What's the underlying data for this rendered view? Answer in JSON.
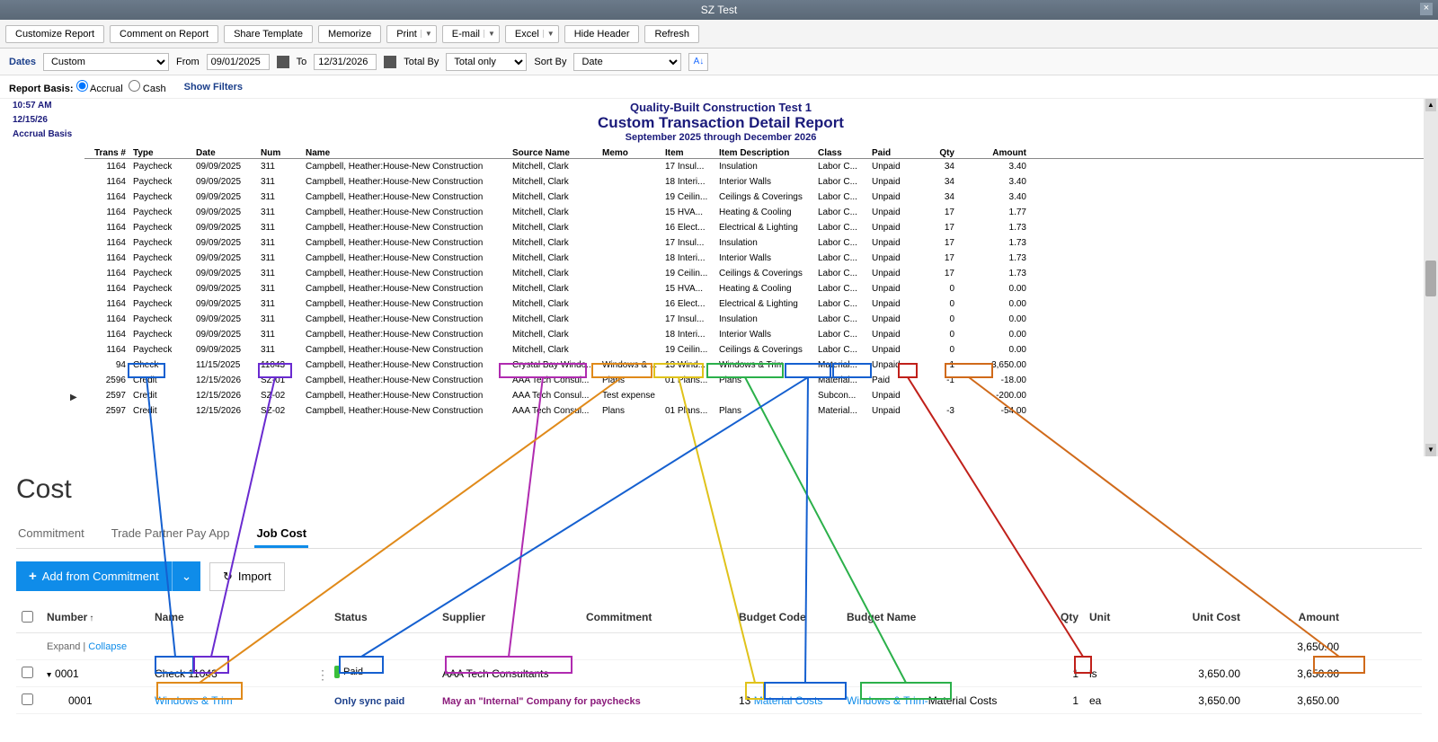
{
  "qb": {
    "window_title": "SZ Test",
    "toolbar": {
      "customize": "Customize Report",
      "comment": "Comment on Report",
      "share": "Share Template",
      "memorize": "Memorize",
      "print": "Print",
      "email": "E-mail",
      "excel": "Excel",
      "hide_header": "Hide Header",
      "refresh": "Refresh"
    },
    "filters": {
      "dates_label": "Dates",
      "dates_value": "Custom",
      "from_label": "From",
      "from_value": "09/01/2025",
      "to_label": "To",
      "to_value": "12/31/2026",
      "totalby_label": "Total By",
      "totalby_value": "Total only",
      "sortby_label": "Sort By",
      "sortby_value": "Date"
    },
    "basis": {
      "label": "Report Basis:",
      "accrual": "Accrual",
      "cash": "Cash",
      "show_filters": "Show Filters"
    },
    "meta": {
      "time": "10:57 AM",
      "date": "12/15/26",
      "basis": "Accrual Basis"
    },
    "header": {
      "company": "Quality-Built Construction Test 1",
      "title": "Custom Transaction Detail Report",
      "range": "September 2025 through December 2026"
    },
    "cols": [
      "Trans #",
      "Type",
      "Date",
      "Num",
      "Name",
      "Source Name",
      "Memo",
      "Item",
      "Item Description",
      "Class",
      "Paid",
      "Qty",
      "Amount"
    ],
    "rows": [
      {
        "trans": "1164",
        "type": "Paycheck",
        "date": "09/09/2025",
        "num": "311",
        "name": "Campbell, Heather:House-New Construction",
        "src": "Mitchell, Clark",
        "memo": "",
        "item": "17 Insul...",
        "desc": "Insulation",
        "class": "Labor C...",
        "paid": "Unpaid",
        "qty": "34",
        "amt": "3.40"
      },
      {
        "trans": "1164",
        "type": "Paycheck",
        "date": "09/09/2025",
        "num": "311",
        "name": "Campbell, Heather:House-New Construction",
        "src": "Mitchell, Clark",
        "memo": "",
        "item": "18 Interi...",
        "desc": "Interior Walls",
        "class": "Labor C...",
        "paid": "Unpaid",
        "qty": "34",
        "amt": "3.40"
      },
      {
        "trans": "1164",
        "type": "Paycheck",
        "date": "09/09/2025",
        "num": "311",
        "name": "Campbell, Heather:House-New Construction",
        "src": "Mitchell, Clark",
        "memo": "",
        "item": "19 Ceilin...",
        "desc": "Ceilings & Coverings",
        "class": "Labor C...",
        "paid": "Unpaid",
        "qty": "34",
        "amt": "3.40"
      },
      {
        "trans": "1164",
        "type": "Paycheck",
        "date": "09/09/2025",
        "num": "311",
        "name": "Campbell, Heather:House-New Construction",
        "src": "Mitchell, Clark",
        "memo": "",
        "item": "15 HVA...",
        "desc": "Heating & Cooling",
        "class": "Labor C...",
        "paid": "Unpaid",
        "qty": "17",
        "amt": "1.77"
      },
      {
        "trans": "1164",
        "type": "Paycheck",
        "date": "09/09/2025",
        "num": "311",
        "name": "Campbell, Heather:House-New Construction",
        "src": "Mitchell, Clark",
        "memo": "",
        "item": "16 Elect...",
        "desc": "Electrical & Lighting",
        "class": "Labor C...",
        "paid": "Unpaid",
        "qty": "17",
        "amt": "1.73"
      },
      {
        "trans": "1164",
        "type": "Paycheck",
        "date": "09/09/2025",
        "num": "311",
        "name": "Campbell, Heather:House-New Construction",
        "src": "Mitchell, Clark",
        "memo": "",
        "item": "17 Insul...",
        "desc": "Insulation",
        "class": "Labor C...",
        "paid": "Unpaid",
        "qty": "17",
        "amt": "1.73"
      },
      {
        "trans": "1164",
        "type": "Paycheck",
        "date": "09/09/2025",
        "num": "311",
        "name": "Campbell, Heather:House-New Construction",
        "src": "Mitchell, Clark",
        "memo": "",
        "item": "18 Interi...",
        "desc": "Interior Walls",
        "class": "Labor C...",
        "paid": "Unpaid",
        "qty": "17",
        "amt": "1.73"
      },
      {
        "trans": "1164",
        "type": "Paycheck",
        "date": "09/09/2025",
        "num": "311",
        "name": "Campbell, Heather:House-New Construction",
        "src": "Mitchell, Clark",
        "memo": "",
        "item": "19 Ceilin...",
        "desc": "Ceilings & Coverings",
        "class": "Labor C...",
        "paid": "Unpaid",
        "qty": "17",
        "amt": "1.73"
      },
      {
        "trans": "1164",
        "type": "Paycheck",
        "date": "09/09/2025",
        "num": "311",
        "name": "Campbell, Heather:House-New Construction",
        "src": "Mitchell, Clark",
        "memo": "",
        "item": "15 HVA...",
        "desc": "Heating & Cooling",
        "class": "Labor C...",
        "paid": "Unpaid",
        "qty": "0",
        "amt": "0.00"
      },
      {
        "trans": "1164",
        "type": "Paycheck",
        "date": "09/09/2025",
        "num": "311",
        "name": "Campbell, Heather:House-New Construction",
        "src": "Mitchell, Clark",
        "memo": "",
        "item": "16 Elect...",
        "desc": "Electrical & Lighting",
        "class": "Labor C...",
        "paid": "Unpaid",
        "qty": "0",
        "amt": "0.00"
      },
      {
        "trans": "1164",
        "type": "Paycheck",
        "date": "09/09/2025",
        "num": "311",
        "name": "Campbell, Heather:House-New Construction",
        "src": "Mitchell, Clark",
        "memo": "",
        "item": "17 Insul...",
        "desc": "Insulation",
        "class": "Labor C...",
        "paid": "Unpaid",
        "qty": "0",
        "amt": "0.00"
      },
      {
        "trans": "1164",
        "type": "Paycheck",
        "date": "09/09/2025",
        "num": "311",
        "name": "Campbell, Heather:House-New Construction",
        "src": "Mitchell, Clark",
        "memo": "",
        "item": "18 Interi...",
        "desc": "Interior Walls",
        "class": "Labor C...",
        "paid": "Unpaid",
        "qty": "0",
        "amt": "0.00"
      },
      {
        "trans": "1164",
        "type": "Paycheck",
        "date": "09/09/2025",
        "num": "311",
        "name": "Campbell, Heather:House-New Construction",
        "src": "Mitchell, Clark",
        "memo": "",
        "item": "19 Ceilin...",
        "desc": "Ceilings & Coverings",
        "class": "Labor C...",
        "paid": "Unpaid",
        "qty": "0",
        "amt": "0.00"
      },
      {
        "trans": "94",
        "type": "Check",
        "date": "11/15/2025",
        "num": "11043",
        "name": "Campbell, Heather:House-New Construction",
        "src": "Crystal Bay Windo...",
        "memo": "Windows & ...",
        "item": "13 Wind...",
        "desc": "Windows & Trim",
        "class": "Material...",
        "paid": "Unpaid",
        "qty": "1",
        "amt": "3,650.00"
      },
      {
        "trans": "2596",
        "type": "Credit",
        "date": "12/15/2026",
        "num": "SZ-01",
        "name": "Campbell, Heather:House-New Construction",
        "src": "AAA Tech Consul...",
        "memo": "Plans",
        "item": "01 Plans...",
        "desc": "Plans",
        "class": "Material...",
        "paid": "Paid",
        "qty": "-1",
        "amt": "-18.00"
      },
      {
        "trans": "2597",
        "type": "Credit",
        "date": "12/15/2026",
        "num": "SZ-02",
        "name": "Campbell, Heather:House-New Construction",
        "src": "AAA Tech Consul...",
        "memo": "Test expense",
        "item": "",
        "desc": "",
        "class": "Subcon...",
        "paid": "Unpaid",
        "qty": "",
        "amt": "-200.00"
      },
      {
        "trans": "2597",
        "type": "Credit",
        "date": "12/15/2026",
        "num": "SZ-02",
        "name": "Campbell, Heather:House-New Construction",
        "src": "AAA Tech Consul...",
        "memo": "Plans",
        "item": "01 Plans...",
        "desc": "Plans",
        "class": "Material...",
        "paid": "Unpaid",
        "qty": "-3",
        "amt": "-54.00"
      }
    ]
  },
  "cost": {
    "title": "Cost",
    "tabs": {
      "commitment": "Commitment",
      "trade": "Trade Partner Pay App",
      "jobcost": "Job Cost"
    },
    "actions": {
      "add": "Add from Commitment",
      "import": "Import"
    },
    "cols": {
      "number": "Number",
      "name": "Name",
      "status": "Status",
      "supplier": "Supplier",
      "commitment": "Commitment",
      "bcode": "Budget Code",
      "bname": "Budget Name",
      "qty": "Qty",
      "unit": "Unit",
      "ucost": "Unit Cost",
      "amount": "Amount"
    },
    "expand": "Expand",
    "collapse": "Collapse",
    "total_amount": "3,650.00",
    "row1": {
      "num": "0001",
      "name": "Check 11043",
      "status": "Paid",
      "supplier": "AAA Tech Consultants",
      "qty": "1",
      "unit": "ls",
      "ucost": "3,650.00",
      "amount": "3,650.00"
    },
    "row2": {
      "num": "0001",
      "name": "Windows & Trim",
      "bcode": "13",
      "bcode_rest": "Material Costs",
      "bname": "Windows & Trim-",
      "bname_rest": "Material Costs",
      "qty": "1",
      "unit": "ea",
      "ucost": "3,650.00",
      "amount": "3,650.00"
    },
    "notes": {
      "sync": "Only sync paid",
      "internal": "May an \"Internal\" Company for paychecks"
    }
  }
}
